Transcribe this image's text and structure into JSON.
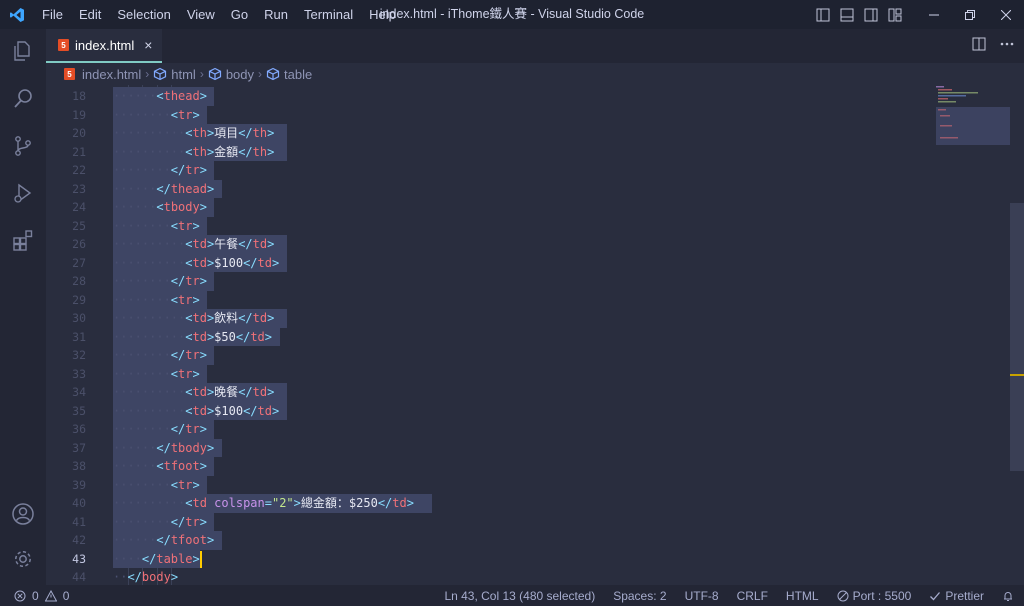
{
  "window": {
    "title": "index.html - iThome鐵人賽 - Visual Studio Code"
  },
  "menu": [
    "File",
    "Edit",
    "Selection",
    "View",
    "Go",
    "Run",
    "Terminal",
    "Help"
  ],
  "tab": {
    "label": "index.html",
    "badge": "5",
    "close": "×"
  },
  "breadcrumb": {
    "file": "index.html",
    "items": [
      "html",
      "body",
      "table"
    ]
  },
  "editor": {
    "lines": [
      {
        "n": "18",
        "indent": 3,
        "tokens": [
          {
            "t": "<",
            "c": "brk"
          },
          {
            "t": "thead",
            "c": "tag"
          },
          {
            "t": ">",
            "c": "brk"
          }
        ]
      },
      {
        "n": "19",
        "indent": 4,
        "tokens": [
          {
            "t": "<",
            "c": "brk"
          },
          {
            "t": "tr",
            "c": "tag"
          },
          {
            "t": ">",
            "c": "brk"
          }
        ]
      },
      {
        "n": "20",
        "indent": 5,
        "tokens": [
          {
            "t": "<",
            "c": "brk"
          },
          {
            "t": "th",
            "c": "tag"
          },
          {
            "t": ">",
            "c": "brk"
          },
          {
            "t": "項目",
            "c": "txt"
          },
          {
            "t": "</",
            "c": "brk"
          },
          {
            "t": "th",
            "c": "tag"
          },
          {
            "t": ">",
            "c": "brk"
          }
        ]
      },
      {
        "n": "21",
        "indent": 5,
        "tokens": [
          {
            "t": "<",
            "c": "brk"
          },
          {
            "t": "th",
            "c": "tag"
          },
          {
            "t": ">",
            "c": "brk"
          },
          {
            "t": "金額",
            "c": "txt"
          },
          {
            "t": "</",
            "c": "brk"
          },
          {
            "t": "th",
            "c": "tag"
          },
          {
            "t": ">",
            "c": "brk"
          }
        ]
      },
      {
        "n": "22",
        "indent": 4,
        "tokens": [
          {
            "t": "</",
            "c": "brk"
          },
          {
            "t": "tr",
            "c": "tag"
          },
          {
            "t": ">",
            "c": "brk"
          }
        ]
      },
      {
        "n": "23",
        "indent": 3,
        "tokens": [
          {
            "t": "</",
            "c": "brk"
          },
          {
            "t": "thead",
            "c": "tag"
          },
          {
            "t": ">",
            "c": "brk"
          }
        ]
      },
      {
        "n": "24",
        "indent": 3,
        "tokens": [
          {
            "t": "<",
            "c": "brk"
          },
          {
            "t": "tbody",
            "c": "tag"
          },
          {
            "t": ">",
            "c": "brk"
          }
        ]
      },
      {
        "n": "25",
        "indent": 4,
        "tokens": [
          {
            "t": "<",
            "c": "brk"
          },
          {
            "t": "tr",
            "c": "tag"
          },
          {
            "t": ">",
            "c": "brk"
          }
        ]
      },
      {
        "n": "26",
        "indent": 5,
        "tokens": [
          {
            "t": "<",
            "c": "brk"
          },
          {
            "t": "td",
            "c": "tag"
          },
          {
            "t": ">",
            "c": "brk"
          },
          {
            "t": "午餐",
            "c": "txt"
          },
          {
            "t": "</",
            "c": "brk"
          },
          {
            "t": "td",
            "c": "tag"
          },
          {
            "t": ">",
            "c": "brk"
          }
        ]
      },
      {
        "n": "27",
        "indent": 5,
        "tokens": [
          {
            "t": "<",
            "c": "brk"
          },
          {
            "t": "td",
            "c": "tag"
          },
          {
            "t": ">",
            "c": "brk"
          },
          {
            "t": "$100",
            "c": "txt"
          },
          {
            "t": "</",
            "c": "brk"
          },
          {
            "t": "td",
            "c": "tag"
          },
          {
            "t": ">",
            "c": "brk"
          }
        ]
      },
      {
        "n": "28",
        "indent": 4,
        "tokens": [
          {
            "t": "</",
            "c": "brk"
          },
          {
            "t": "tr",
            "c": "tag"
          },
          {
            "t": ">",
            "c": "brk"
          }
        ]
      },
      {
        "n": "29",
        "indent": 4,
        "tokens": [
          {
            "t": "<",
            "c": "brk"
          },
          {
            "t": "tr",
            "c": "tag"
          },
          {
            "t": ">",
            "c": "brk"
          }
        ]
      },
      {
        "n": "30",
        "indent": 5,
        "tokens": [
          {
            "t": "<",
            "c": "brk"
          },
          {
            "t": "td",
            "c": "tag"
          },
          {
            "t": ">",
            "c": "brk"
          },
          {
            "t": "飲料",
            "c": "txt"
          },
          {
            "t": "</",
            "c": "brk"
          },
          {
            "t": "td",
            "c": "tag"
          },
          {
            "t": ">",
            "c": "brk"
          }
        ]
      },
      {
        "n": "31",
        "indent": 5,
        "tokens": [
          {
            "t": "<",
            "c": "brk"
          },
          {
            "t": "td",
            "c": "tag"
          },
          {
            "t": ">",
            "c": "brk"
          },
          {
            "t": "$50",
            "c": "txt"
          },
          {
            "t": "</",
            "c": "brk"
          },
          {
            "t": "td",
            "c": "tag"
          },
          {
            "t": ">",
            "c": "brk"
          }
        ]
      },
      {
        "n": "32",
        "indent": 4,
        "tokens": [
          {
            "t": "</",
            "c": "brk"
          },
          {
            "t": "tr",
            "c": "tag"
          },
          {
            "t": ">",
            "c": "brk"
          }
        ]
      },
      {
        "n": "33",
        "indent": 4,
        "tokens": [
          {
            "t": "<",
            "c": "brk"
          },
          {
            "t": "tr",
            "c": "tag"
          },
          {
            "t": ">",
            "c": "brk"
          }
        ]
      },
      {
        "n": "34",
        "indent": 5,
        "tokens": [
          {
            "t": "<",
            "c": "brk"
          },
          {
            "t": "td",
            "c": "tag"
          },
          {
            "t": ">",
            "c": "brk"
          },
          {
            "t": "晚餐",
            "c": "txt"
          },
          {
            "t": "</",
            "c": "brk"
          },
          {
            "t": "td",
            "c": "tag"
          },
          {
            "t": ">",
            "c": "brk"
          }
        ]
      },
      {
        "n": "35",
        "indent": 5,
        "tokens": [
          {
            "t": "<",
            "c": "brk"
          },
          {
            "t": "td",
            "c": "tag"
          },
          {
            "t": ">",
            "c": "brk"
          },
          {
            "t": "$100",
            "c": "txt"
          },
          {
            "t": "</",
            "c": "brk"
          },
          {
            "t": "td",
            "c": "tag"
          },
          {
            "t": ">",
            "c": "brk"
          }
        ]
      },
      {
        "n": "36",
        "indent": 4,
        "tokens": [
          {
            "t": "</",
            "c": "brk"
          },
          {
            "t": "tr",
            "c": "tag"
          },
          {
            "t": ">",
            "c": "brk"
          }
        ]
      },
      {
        "n": "37",
        "indent": 3,
        "tokens": [
          {
            "t": "</",
            "c": "brk"
          },
          {
            "t": "tbody",
            "c": "tag"
          },
          {
            "t": ">",
            "c": "brk"
          }
        ]
      },
      {
        "n": "38",
        "indent": 3,
        "tokens": [
          {
            "t": "<",
            "c": "brk"
          },
          {
            "t": "tfoot",
            "c": "tag"
          },
          {
            "t": ">",
            "c": "brk"
          }
        ]
      },
      {
        "n": "39",
        "indent": 4,
        "tokens": [
          {
            "t": "<",
            "c": "brk"
          },
          {
            "t": "tr",
            "c": "tag"
          },
          {
            "t": ">",
            "c": "brk"
          }
        ]
      },
      {
        "n": "40",
        "indent": 5,
        "tokens": [
          {
            "t": "<",
            "c": "brk"
          },
          {
            "t": "td",
            "c": "tag"
          },
          {
            "t": " ",
            "c": "txt"
          },
          {
            "t": "colspan",
            "c": "attr"
          },
          {
            "t": "=",
            "c": "brk"
          },
          {
            "t": "\"2\"",
            "c": "str"
          },
          {
            "t": ">",
            "c": "brk"
          },
          {
            "t": "總金額：",
            "c": "txt"
          },
          {
            "t": "$250",
            "c": "txt"
          },
          {
            "t": "</",
            "c": "brk"
          },
          {
            "t": "td",
            "c": "tag"
          },
          {
            "t": ">",
            "c": "brk"
          }
        ]
      },
      {
        "n": "41",
        "indent": 4,
        "tokens": [
          {
            "t": "</",
            "c": "brk"
          },
          {
            "t": "tr",
            "c": "tag"
          },
          {
            "t": ">",
            "c": "brk"
          }
        ]
      },
      {
        "n": "42",
        "indent": 3,
        "tokens": [
          {
            "t": "</",
            "c": "brk"
          },
          {
            "t": "tfoot",
            "c": "tag"
          },
          {
            "t": ">",
            "c": "brk"
          }
        ]
      },
      {
        "n": "43",
        "indent": 2,
        "tokens": [
          {
            "t": "</",
            "c": "brk"
          },
          {
            "t": "table",
            "c": "tag"
          },
          {
            "t": ">",
            "c": "brk"
          }
        ],
        "active": true
      },
      {
        "n": "44",
        "indent": 1,
        "tokens": [
          {
            "t": "</",
            "c": "brk"
          },
          {
            "t": "body",
            "c": "tag"
          },
          {
            "t": ">",
            "c": "brk"
          }
        ],
        "unselected": true
      }
    ]
  },
  "status": {
    "errors": "0",
    "warnings": "0",
    "position": "Ln 43, Col 13 (480 selected)",
    "spaces": "Spaces: 2",
    "encoding": "UTF-8",
    "eol": "CRLF",
    "language": "HTML",
    "port": "Port : 5500",
    "prettier": "Prettier"
  },
  "colors": {
    "accent": "#80cbc4",
    "cursor": "#ffcc00",
    "html_badge": "#e44d26"
  }
}
